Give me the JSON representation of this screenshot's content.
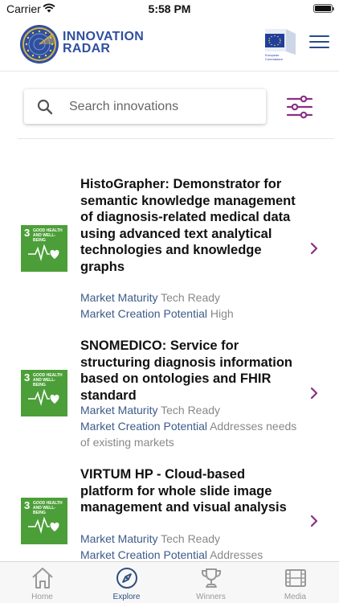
{
  "status": {
    "carrier": "Carrier",
    "time": "5:58 PM"
  },
  "header": {
    "brand_line1": "INNOVATION",
    "brand_line2": "RADAR",
    "ec_text_1": "European",
    "ec_text_2": "Commission",
    "brand_color": "#2f4fa0"
  },
  "search": {
    "placeholder": "Search innovations",
    "value": ""
  },
  "accent_color": "#8b2f86",
  "items": [
    {
      "title": "HistoGrapher: Demonstrator for semantic knowledge management of diagnosis-related medical data using advanced text analytical technologies and knowledge graphs",
      "maturity_label": "Market Maturity",
      "maturity_value": "Tech Ready",
      "potential_label": "Market Creation Potential",
      "potential_value": "High",
      "sdg_number": "3",
      "sdg_text": "GOOD HEALTH AND WELL-BEING"
    },
    {
      "title": "SNOMEDICO: Service for structuring diagnosis information based on ontologies and FHIR standard",
      "maturity_label": "Market Maturity",
      "maturity_value": "Tech Ready",
      "potential_label": "Market Creation Potential",
      "potential_value": "Addresses needs of existing markets",
      "sdg_number": "3",
      "sdg_text": "GOOD HEALTH AND WELL-BEING"
    },
    {
      "title": "VIRTUM HP - Cloud-based platform for whole slide image management and visual analysis",
      "maturity_label": "Market Maturity",
      "maturity_value": "Tech Ready",
      "potential_label": "Market Creation Potential",
      "potential_value": "Addresses",
      "sdg_number": "3",
      "sdg_text": "GOOD HEALTH AND WELL-BEING"
    }
  ],
  "tabs": [
    {
      "label": "Home",
      "icon": "home-icon",
      "active": false
    },
    {
      "label": "Explore",
      "icon": "compass-icon",
      "active": true
    },
    {
      "label": "Winners",
      "icon": "trophy-icon",
      "active": false
    },
    {
      "label": "Media",
      "icon": "film-icon",
      "active": false
    }
  ]
}
